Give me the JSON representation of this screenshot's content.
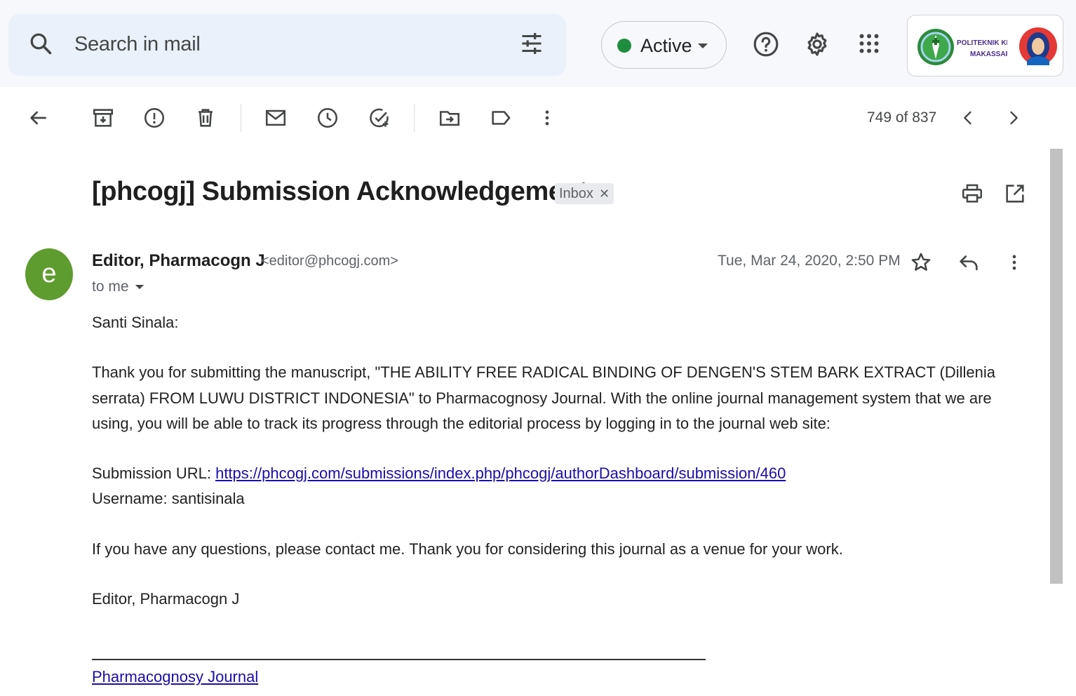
{
  "search": {
    "placeholder": "Search in mail",
    "icon": "search-icon",
    "filter_icon": "tune-icon"
  },
  "status": {
    "label": "Active",
    "color": "#1e8e3e"
  },
  "top_icons": [
    "help-icon",
    "settings-icon",
    "apps-icon"
  ],
  "account": {
    "logo_text_line1": "POLITEKNIK KESEHATAN",
    "logo_text_line2": "MAKASSAR"
  },
  "toolbar": {
    "icons": [
      "back-arrow-icon",
      "archive-icon",
      "report-spam-icon",
      "delete-icon",
      "mark-unread-icon",
      "snooze-icon",
      "add-task-icon",
      "move-to-icon",
      "label-icon",
      "more-vert-icon"
    ],
    "count": "749 of 837"
  },
  "message": {
    "subject": "[phcogj] Submission Acknowledgement",
    "label_chip": "Inbox",
    "avatar_letter": "e",
    "avatar_color": "#5f9c2f",
    "sender_name": "Editor, Pharmacogn J",
    "sender_email": "<editor@phcogj.com>",
    "recipient": "to me",
    "date": "Tue, Mar 24, 2020, 2:50 PM",
    "body": {
      "greeting": "Santi Sinala:",
      "paragraph1": "Thank you for submitting the manuscript, \"THE ABILITY FREE RADICAL BINDING OF DENGEN'S STEM BARK EXTRACT (Dillenia serrata) FROM LUWU DISTRICT INDONESIA\" to Pharmacognosy Journal. With the online journal management system that we are using, you will be able to track its progress through the editorial process by logging in to the journal web site:",
      "url_label": "Submission URL:",
      "url": "https://phcogj.com/submissions/index.php/phcogj/authorDashboard/submission/460",
      "username_line": "Username: santisinala",
      "paragraph2": "If you have any questions, please contact me. Thank you for considering this journal as a venue for your work.",
      "signoff": "Editor, Pharmacogn J",
      "signature_link": "Pharmacognosy Journal"
    }
  }
}
